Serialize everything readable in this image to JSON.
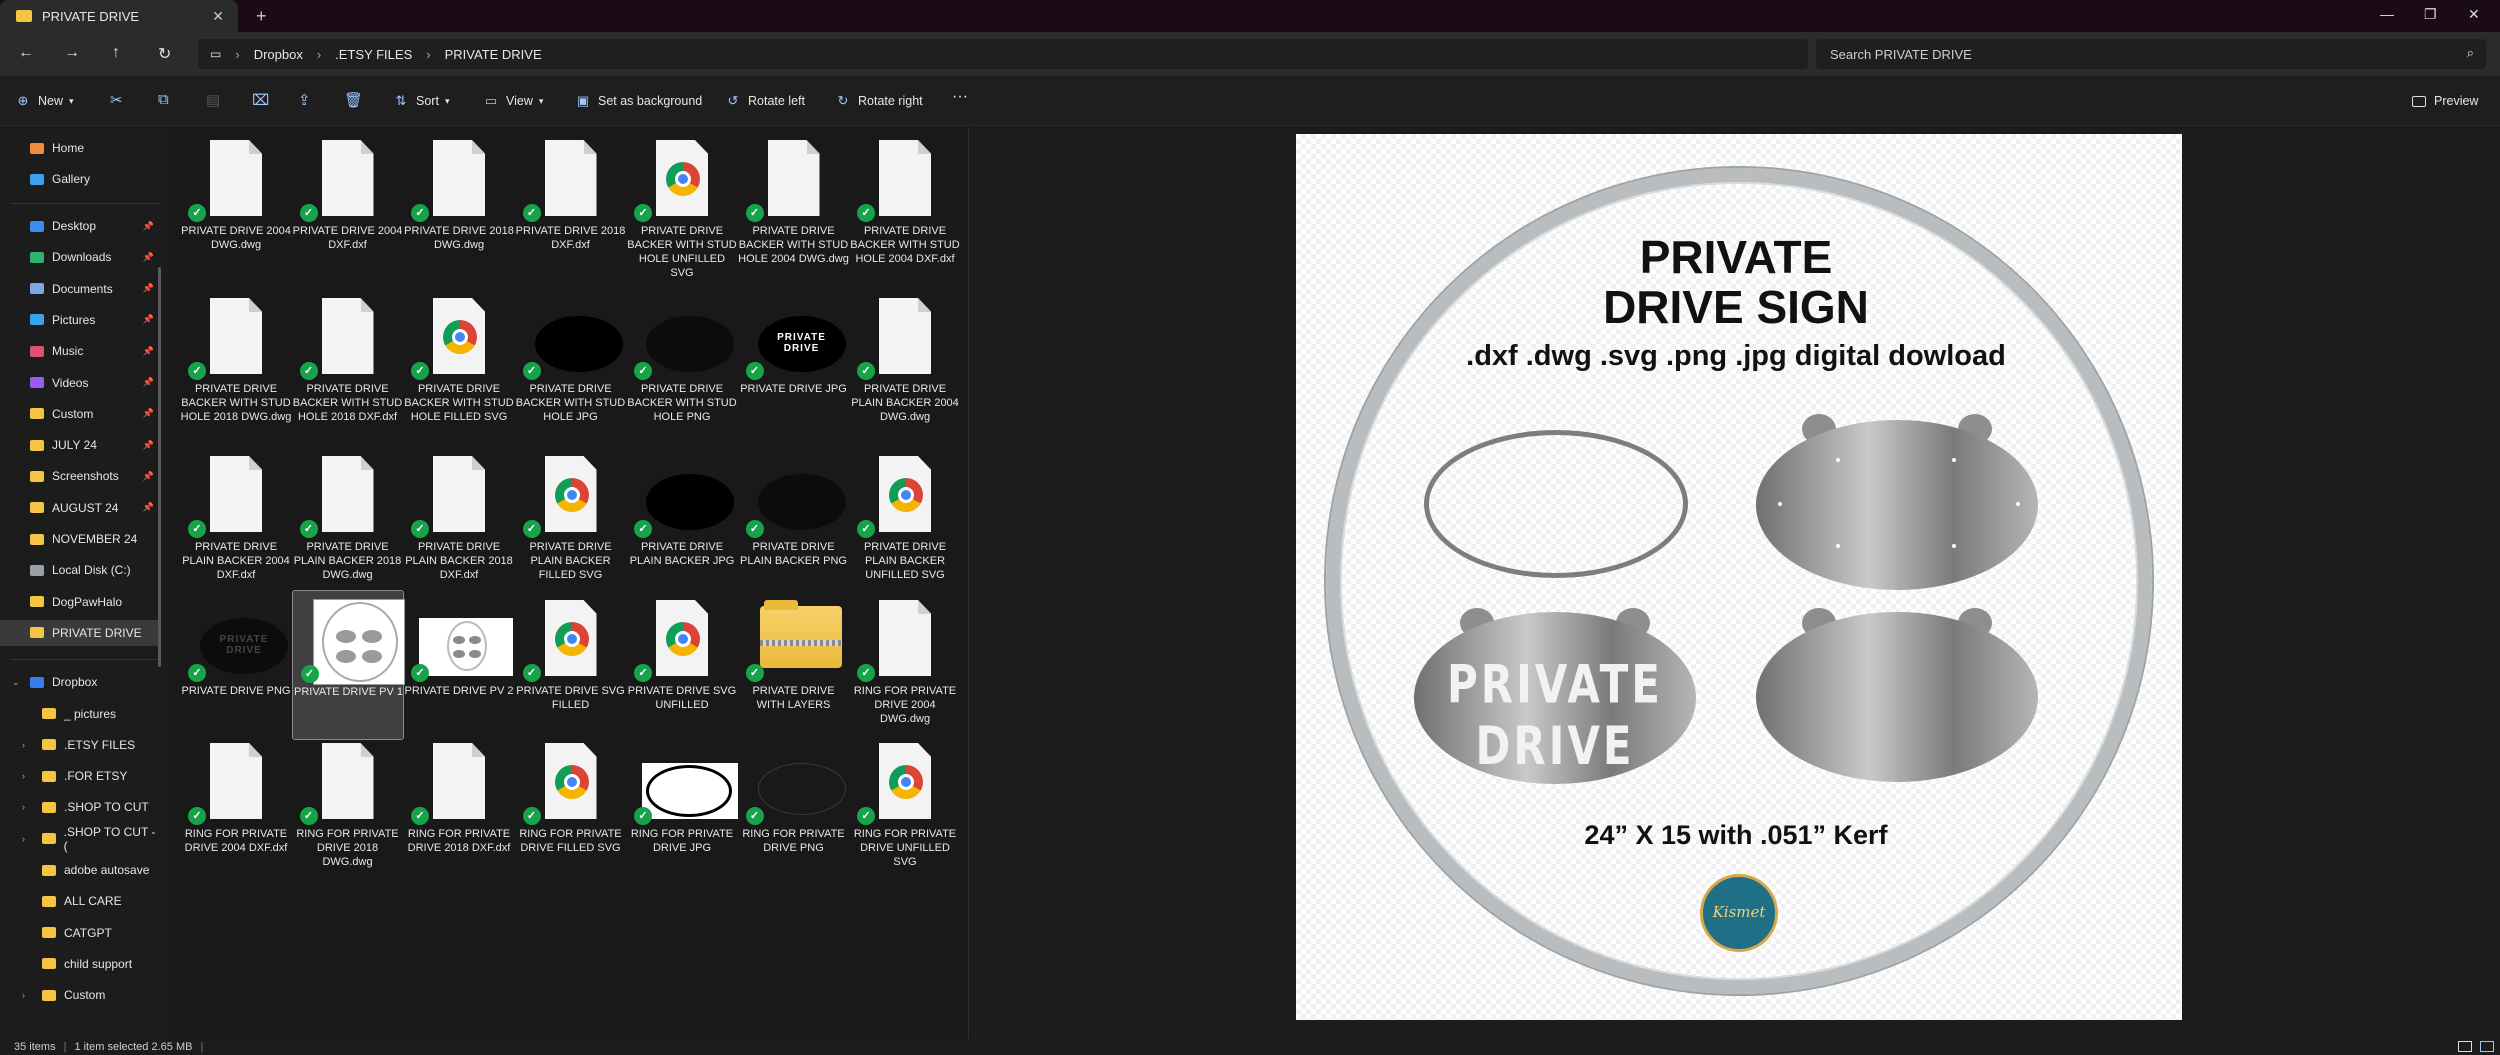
{
  "window": {
    "tab_title": "PRIVATE DRIVE",
    "tab_close": "✕",
    "new_tab": "+",
    "controls": [
      "—",
      "❐",
      "✕"
    ]
  },
  "address": {
    "crumbs": [
      "Dropbox",
      ".ETSY FILES",
      "PRIVATE DRIVE"
    ],
    "search_placeholder": "Search PRIVATE DRIVE"
  },
  "commands": {
    "new": "New",
    "sort": "Sort",
    "view": "View",
    "set_background": "Set as background",
    "rotate_left": "Rotate left",
    "rotate_right": "Rotate right",
    "more": "···",
    "preview": "Preview"
  },
  "sidebar": {
    "top": [
      {
        "label": "Home",
        "color": "#f08c3a"
      },
      {
        "label": "Gallery",
        "color": "#3aa0f0"
      }
    ],
    "pinned": [
      {
        "label": "Desktop",
        "color": "#3a8cf0"
      },
      {
        "label": "Downloads",
        "color": "#2fb36e"
      },
      {
        "label": "Documents",
        "color": "#7aa8e0"
      },
      {
        "label": "Pictures",
        "color": "#3aa0f0"
      },
      {
        "label": "Music",
        "color": "#e0506e"
      },
      {
        "label": "Videos",
        "color": "#9a5cf0"
      },
      {
        "label": "Custom",
        "color": "#f5c542"
      },
      {
        "label": "JULY 24",
        "color": "#f5c542"
      },
      {
        "label": "Screenshots",
        "color": "#f5c542"
      },
      {
        "label": "AUGUST 24",
        "color": "#f5c542"
      },
      {
        "label": "NOVEMBER 24",
        "color": "#f5c542"
      },
      {
        "label": "Local Disk (C:)",
        "color": "#9aa0a6"
      },
      {
        "label": "DogPawHalo",
        "color": "#f5c542"
      },
      {
        "label": "PRIVATE DRIVE",
        "color": "#f5c542"
      }
    ],
    "dropbox_label": "Dropbox",
    "dropbox_children": [
      {
        "label": "_ pictures",
        "chev": ""
      },
      {
        "label": ".ETSY FILES",
        "chev": "›"
      },
      {
        "label": ".FOR ETSY",
        "chev": "›"
      },
      {
        "label": ".SHOP TO CUT",
        "chev": "›"
      },
      {
        "label": ".SHOP TO CUT - (",
        "chev": "›"
      },
      {
        "label": "adobe autosave",
        "chev": ""
      },
      {
        "label": "ALL CARE",
        "chev": ""
      },
      {
        "label": "CATGPT",
        "chev": ""
      },
      {
        "label": "child support",
        "chev": ""
      },
      {
        "label": "Custom",
        "chev": "›"
      }
    ]
  },
  "files": [
    {
      "label": "PRIVATE DRIVE 2004 DWG.dwg",
      "kind": "doc"
    },
    {
      "label": "PRIVATE DRIVE 2004 DXF.dxf",
      "kind": "doc"
    },
    {
      "label": "PRIVATE DRIVE 2018 DWG.dwg",
      "kind": "doc"
    },
    {
      "label": "PRIVATE DRIVE 2018 DXF.dxf",
      "kind": "doc"
    },
    {
      "label": "PRIVATE DRIVE BACKER WITH STUD HOLE UNFILLED SVG",
      "kind": "chrome"
    },
    {
      "label": "PRIVATE DRIVE BACKER WITH STUD HOLE 2004 DWG.dwg",
      "kind": "doc"
    },
    {
      "label": "PRIVATE DRIVE BACKER WITH STUD HOLE 2004 DXF.dxf",
      "kind": "doc"
    },
    {
      "label": "PRIVATE DRIVE BACKER WITH STUD HOLE 2018 DWG.dwg",
      "kind": "doc"
    },
    {
      "label": "PRIVATE DRIVE BACKER WITH STUD HOLE 2018 DXF.dxf",
      "kind": "doc"
    },
    {
      "label": "PRIVATE DRIVE BACKER WITH STUD HOLE FILLED SVG",
      "kind": "chrome"
    },
    {
      "label": "PRIVATE DRIVE BACKER WITH STUD HOLE JPG",
      "kind": "black"
    },
    {
      "label": "PRIVATE DRIVE BACKER WITH STUD HOLE PNG",
      "kind": "dark"
    },
    {
      "label": "PRIVATE DRIVE JPG",
      "kind": "blacklabel",
      "thumb_text": "PRIVATE DRIVE"
    },
    {
      "label": "PRIVATE DRIVE PLAIN BACKER 2004 DWG.dwg",
      "kind": "doc"
    },
    {
      "label": "PRIVATE DRIVE PLAIN BACKER 2004 DXF.dxf",
      "kind": "doc"
    },
    {
      "label": "PRIVATE DRIVE PLAIN BACKER 2018 DWG.dwg",
      "kind": "doc"
    },
    {
      "label": "PRIVATE DRIVE PLAIN BACKER 2018 DXF.dxf",
      "kind": "doc"
    },
    {
      "label": "PRIVATE DRIVE PLAIN BACKER FILLED SVG",
      "kind": "chrome"
    },
    {
      "label": "PRIVATE DRIVE PLAIN BACKER JPG",
      "kind": "black"
    },
    {
      "label": "PRIVATE DRIVE PLAIN BACKER PNG",
      "kind": "dark"
    },
    {
      "label": "PRIVATE DRIVE PLAIN BACKER UNFILLED SVG",
      "kind": "chrome"
    },
    {
      "label": "PRIVATE DRIVE PNG",
      "kind": "darklabel",
      "thumb_text": "PRIVATE DRIVE"
    },
    {
      "label": "PRIVATE DRIVE PV 1",
      "kind": "pv1",
      "selected": true
    },
    {
      "label": "PRIVATE DRIVE PV 2",
      "kind": "pv2"
    },
    {
      "label": "PRIVATE DRIVE SVG FILLED",
      "kind": "chrome"
    },
    {
      "label": "PRIVATE DRIVE SVG UNFILLED",
      "kind": "chrome"
    },
    {
      "label": "PRIVATE DRIVE WITH LAYERS",
      "kind": "zip"
    },
    {
      "label": "RING FOR PRIVATE DRIVE 2004 DWG.dwg",
      "kind": "doc"
    },
    {
      "label": "RING FOR PRIVATE DRIVE 2004 DXF.dxf",
      "kind": "doc"
    },
    {
      "label": "RING FOR PRIVATE DRIVE 2018 DWG.dwg",
      "kind": "doc"
    },
    {
      "label": "RING FOR PRIVATE DRIVE 2018 DXF.dxf",
      "kind": "doc"
    },
    {
      "label": "RING FOR PRIVATE DRIVE FILLED SVG",
      "kind": "chrome"
    },
    {
      "label": "RING FOR PRIVATE DRIVE JPG",
      "kind": "white"
    },
    {
      "label": "RING FOR PRIVATE DRIVE PNG",
      "kind": "ringdark"
    },
    {
      "label": "RING FOR PRIVATE DRIVE UNFILLED SVG",
      "kind": "chrome"
    }
  ],
  "preview": {
    "title_line1": "PRIVATE",
    "title_line2": "DRIVE SIGN",
    "formats": ".dxf .dwg .svg .png .jpg digital dowload",
    "sign_text": "PRIVATE DRIVE",
    "size_text": "24” X 15 with .051” Kerf",
    "logo_text": "Kismet"
  },
  "status": {
    "items": "35 items",
    "selected": "1 item selected  2.65 MB"
  }
}
